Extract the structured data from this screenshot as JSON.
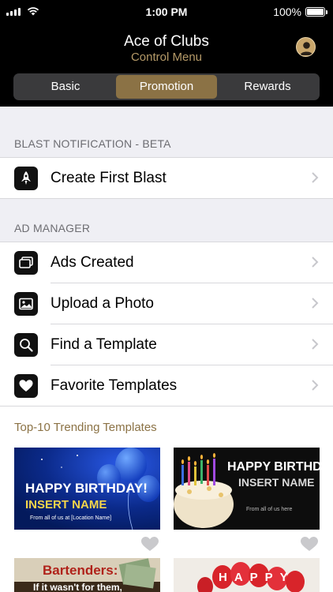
{
  "status_bar": {
    "time": "1:00 PM",
    "battery": "100%"
  },
  "header": {
    "title": "Ace of Clubs",
    "subtitle": "Control Menu"
  },
  "tabs": [
    {
      "label": "Basic"
    },
    {
      "label": "Promotion"
    },
    {
      "label": "Rewards"
    }
  ],
  "blast": {
    "heading": "BLAST NOTIFICATION - BETA",
    "items": [
      {
        "label": "Create First Blast",
        "icon": "rocket-icon"
      }
    ]
  },
  "ad_manager": {
    "heading": "AD MANAGER",
    "items": [
      {
        "label": "Ads Created",
        "icon": "stack-icon"
      },
      {
        "label": "Upload a Photo",
        "icon": "photo-icon"
      },
      {
        "label": "Find a Template",
        "icon": "search-icon"
      },
      {
        "label": "Favorite Templates",
        "icon": "heart-icon"
      }
    ]
  },
  "trending": {
    "heading": "Top-10 Trending Templates",
    "cards": [
      {
        "line1": "HAPPY BIRTHDAY!",
        "line2": "INSERT NAME",
        "line3": "From all of us at [Location Name]"
      },
      {
        "line1": "HAPPY BIRTHDAY!",
        "line2": "INSERT NAME",
        "line3": "From all of us here"
      },
      {
        "line1": "Bartenders:",
        "line2": "If it wasn't for them,"
      },
      {
        "line1": "HAPPY"
      }
    ]
  },
  "colors": {
    "accent": "#8b7245",
    "header_bg": "#000000",
    "subtitle": "#b59a68"
  }
}
